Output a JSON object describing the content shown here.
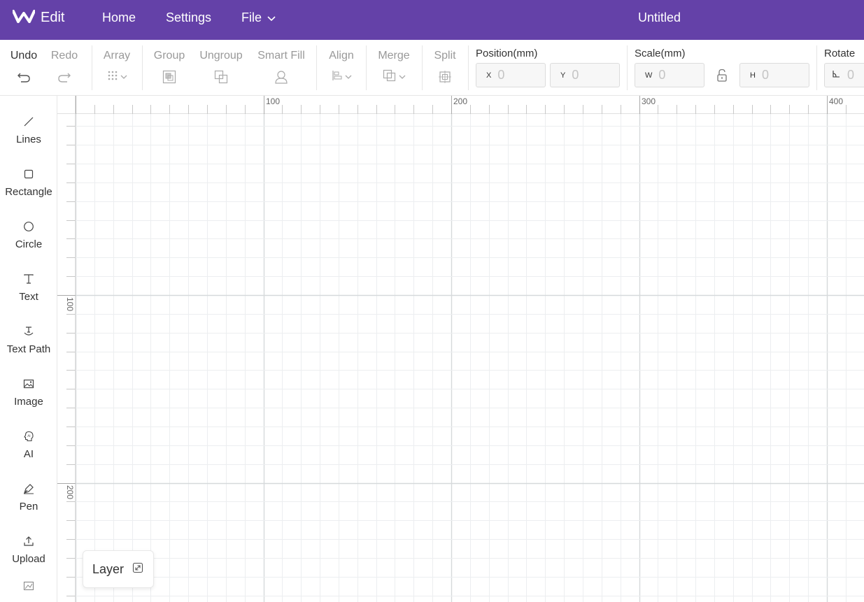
{
  "app": {
    "brand_label": "Edit",
    "doc_title": "Untitled",
    "accent": "#6441a8"
  },
  "nav": {
    "home": "Home",
    "settings": "Settings",
    "file": "File"
  },
  "toolbar": {
    "undo": "Undo",
    "redo": "Redo",
    "array": "Array",
    "group": "Group",
    "ungroup": "Ungroup",
    "smart_fill": "Smart Fill",
    "align": "Align",
    "merge": "Merge",
    "split": "Split",
    "position": {
      "title": "Position(mm)",
      "x_prefix": "X",
      "x_value": "0",
      "y_prefix": "Y",
      "y_value": "0"
    },
    "scale": {
      "title": "Scale(mm)",
      "w_prefix": "W",
      "w_value": "0",
      "h_prefix": "H",
      "h_value": "0"
    },
    "rotate": {
      "title": "Rotate",
      "value": "0"
    }
  },
  "sidebar": {
    "items": [
      {
        "label": "Lines",
        "icon": "line-icon"
      },
      {
        "label": "Rectangle",
        "icon": "rectangle-icon"
      },
      {
        "label": "Circle",
        "icon": "circle-icon"
      },
      {
        "label": "Text",
        "icon": "text-icon"
      },
      {
        "label": "Text Path",
        "icon": "text-path-icon"
      },
      {
        "label": "Image",
        "icon": "image-icon"
      },
      {
        "label": "AI",
        "icon": "ai-icon"
      },
      {
        "label": "Pen",
        "icon": "pen-icon"
      },
      {
        "label": "Upload",
        "icon": "upload-icon"
      }
    ]
  },
  "rulers": {
    "top_labels": [
      "100",
      "200",
      "300",
      "400"
    ],
    "left_labels": [
      "100",
      "200"
    ]
  },
  "layer": {
    "label": "Layer"
  }
}
